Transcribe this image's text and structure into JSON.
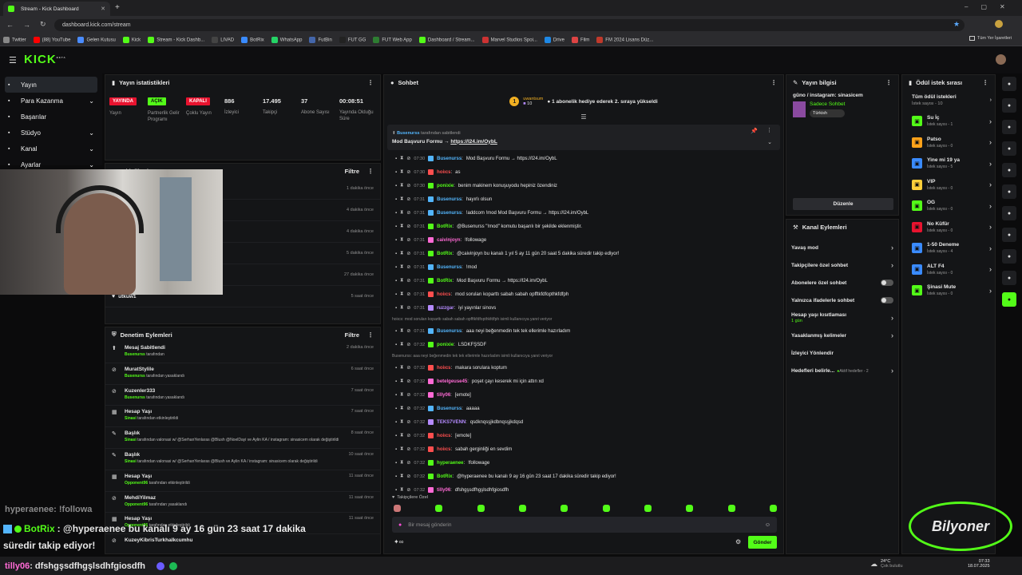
{
  "browser": {
    "tab_title": "Stream - Kick Dashboard",
    "url": "dashboard.kick.com/stream",
    "bookmarks": [
      "Twitter",
      "(88) YouTube",
      "Gelen Kutusu",
      "Kick",
      "Stream - Kick Dashb...",
      "LIVAD",
      "BotRix",
      "WhatsApp",
      "FutBin",
      "FUT GG",
      "FUT Web App",
      "Dashboard / Stream...",
      "Marvel Studios Spoi...",
      "Drive",
      "Film",
      "FM 2024 Lisans Düz..."
    ],
    "all_bookmarks": "Tüm Yer İşaretleri"
  },
  "app": {
    "logo": "KICK",
    "logo_sup": "BETA"
  },
  "sidebar": {
    "items": [
      {
        "icon": "live-icon",
        "label": "Yayın",
        "active": true,
        "chevron": false
      },
      {
        "icon": "money-icon",
        "label": "Para Kazanma",
        "active": false,
        "chevron": true
      },
      {
        "icon": "trophy-icon",
        "label": "Başarılar",
        "active": false,
        "chevron": false
      },
      {
        "icon": "studio-icon",
        "label": "Stüdyo",
        "active": false,
        "chevron": true
      },
      {
        "icon": "channel-icon",
        "label": "Kanal",
        "active": false,
        "chevron": true
      },
      {
        "icon": "gear-icon",
        "label": "Ayarlar",
        "active": false,
        "chevron": true
      }
    ]
  },
  "stats": {
    "title": "Yayın istatistikleri",
    "items": [
      {
        "badge": "YAYINDA",
        "badge_color": "#e8132f",
        "label": "Yayın"
      },
      {
        "badge": "AÇIK",
        "badge_color": "#53fc18",
        "label": "Partnerlik Gelir Programı"
      },
      {
        "badge": "KAPALI",
        "badge_color": "#e8132f",
        "label": "Çoklu Yayın"
      },
      {
        "value": "886",
        "label": "İzleyici"
      },
      {
        "value": "17.495",
        "label": "Takipçi"
      },
      {
        "value": "37",
        "label": "Abone Sayısı"
      },
      {
        "value": "00:08:51",
        "label": "Yayında Olduğu Süre"
      }
    ]
  },
  "activity": {
    "title": "Etkinlik Akışı",
    "filter": "Filtre",
    "times": [
      "1 dakika önce",
      "4 dakika önce",
      "4 dakika önce",
      "5 dakika önce",
      "27 dakika önce",
      "5 saat önce"
    ],
    "partial_user": "mellimori",
    "partial_note": "kanalı takip etti",
    "last_user": "utkuw1"
  },
  "moderation": {
    "title": "Denetim Eylemleri",
    "filter": "Filtre",
    "items": [
      {
        "icon": "pin-icon",
        "title": "Mesaj Sabitlendi",
        "by": "Busenurss",
        "rest": "tarafından",
        "time": "2 dakika önce"
      },
      {
        "icon": "ban-icon",
        "title": "MuratStylile",
        "by": "Busenurss",
        "rest": "tarafından yasaklandı",
        "time": "6 saat önce"
      },
      {
        "icon": "ban-icon",
        "title": "Kuzenler333",
        "by": "Busenurss",
        "rest": "tarafından yasaklandı",
        "time": "7 saat önce"
      },
      {
        "icon": "calendar-icon",
        "title": "Hesap Yaşı",
        "by": "Sinasi",
        "rest": "tarafından etkinleştirildi",
        "time": "7 saat önce"
      },
      {
        "icon": "edit-icon",
        "title": "Başlık",
        "by": "Sinasi",
        "rest": "tarafından valonasi w/ @SerhanYenlaras @Blush @NoelDayi ve Aylin KA / instagram: sinasicem olarak değiştirildi",
        "time": "8 saat önce"
      },
      {
        "icon": "edit-icon",
        "title": "Başlık",
        "by": "Sinasi",
        "rest": "tarafından valonasi w/ @SerhanYenlaras @Blush ve Aylin KA / instagram: sinasicem olarak değiştirildi",
        "time": "10 saat önce"
      },
      {
        "icon": "calendar-icon",
        "title": "Hesap Yaşı",
        "by": "Opponent96",
        "rest": "tarafından etkinleştirildi",
        "time": "11 saat önce"
      },
      {
        "icon": "ban-icon",
        "title": "MehdiYilmaz",
        "by": "Opponent96",
        "rest": "tarafından yasaklandı",
        "time": "11 saat önce"
      },
      {
        "icon": "calendar-icon",
        "title": "Hesap Yaşı",
        "by": "Opponent96",
        "rest": "tarafından etkinleştirildi",
        "time": "11 saat önce"
      },
      {
        "icon": "ban-icon",
        "title": "KuzeyKibrisTurkhalkcumhu",
        "by": "",
        "rest": "",
        "time": ""
      }
    ]
  },
  "chat": {
    "title": "Sohbet",
    "gift_user": "uwantsum",
    "gift_count": "10",
    "gift_text": "1 abonelik hediye ederek 2. sıraya yükseldi",
    "pinned_by": "Busenurss",
    "pinned_rest": "tarafından sabitlendi",
    "pinned_msg": "Mod Başvuru Formu →",
    "pinned_link": "https://l24.im/OybL",
    "messages": [
      {
        "t": "07:30",
        "u": "Busenurss",
        "c": "#53b5fc",
        "m": "Mod Başvuru Formu → https://l24.im/OybL"
      },
      {
        "t": "07:30",
        "u": "hoiıcs",
        "c": "#ff4f4f",
        "m": "as"
      },
      {
        "t": "07:30",
        "u": "ponixie",
        "c": "#53fc18",
        "m": "benim makinem konuşuyodu hepiniz özendiniz"
      },
      {
        "t": "07:31",
        "u": "Busenurss",
        "c": "#53b5fc",
        "m": "hayırlı olsun"
      },
      {
        "t": "07:31",
        "u": "Busenurss",
        "c": "#53b5fc",
        "m": "!addcom !mod Mod Başvuru Formu → https://l24.im/OybL"
      },
      {
        "t": "07:31",
        "u": "BotRix",
        "c": "#53fc18",
        "m": "@Busenurss \"!mod\" komutu başarılı bir şekilde eklenmiştir."
      },
      {
        "t": "07:31",
        "u": "caivinjoyn",
        "c": "#ff6ad5",
        "m": "!followage"
      },
      {
        "t": "07:31",
        "u": "BotRix",
        "c": "#53fc18",
        "m": "@caivinjoyn bu kanalı 1 yıl 5 ay 11 gün 20 saat 5 dakika süredir takip ediyor!"
      },
      {
        "t": "07:31",
        "u": "Busenurss",
        "c": "#53b5fc",
        "m": "!mod"
      },
      {
        "t": "07:31",
        "u": "BotRix",
        "c": "#53fc18",
        "m": "Mod Başvuru Formu → https://l24.im/OybL"
      },
      {
        "t": "07:31",
        "u": "hoiıcs",
        "c": "#ff4f4f",
        "m": "mod soruları koparttı sabah sabah opfftkfdfopthkfdfph"
      },
      {
        "t": "07:31",
        "u": "ruzzgar",
        "c": "#b58bff",
        "m": "iyi yayınlar sinovs"
      },
      {
        "reply": "hoiıcs: mod soruları koparttı sabah sabah opfftkfdfopthkfdfph isimli kullanıcıya yanıt veriyor"
      },
      {
        "t": "07:31",
        "u": "Busenurss",
        "c": "#53b5fc",
        "m": "aaa neyi beğenmedin tek tek ellerimle hazırladım"
      },
      {
        "t": "07:32",
        "u": "ponixie",
        "c": "#53fc18",
        "m": "LSDKFŞSDF"
      },
      {
        "reply": "Busenurss: aaa neyi beğenmedin tek tek ellerimle hazırladım isimli kullanıcıya yanıt veriyor"
      },
      {
        "t": "07:32",
        "u": "hoiıcs",
        "c": "#ff4f4f",
        "m": "makara sorulara koptum"
      },
      {
        "t": "07:32",
        "u": "betelgeuse45",
        "c": "#ff6ad5",
        "m": "poşet çayı keserek mi için attın xd"
      },
      {
        "t": "07:32",
        "u": "tilly06",
        "c": "#ff6ad5",
        "m": "[emote]"
      },
      {
        "t": "07:32",
        "u": "Busenurss",
        "c": "#53b5fc",
        "m": "aaaaa"
      },
      {
        "t": "07:32",
        "u": "TEKS7VENN",
        "c": "#b58bff",
        "m": "qsdknqsşjkdbnqsşjkdqsd"
      },
      {
        "t": "07:32",
        "u": "hoiıcs",
        "c": "#ff4f4f",
        "m": "[emote]"
      },
      {
        "t": "07:32",
        "u": "hoiıcs",
        "c": "#ff4f4f",
        "m": "sabah gerginliği en sevdim"
      },
      {
        "t": "07:32",
        "u": "hyperaenee",
        "c": "#53fc18",
        "m": "!followage"
      },
      {
        "t": "07:32",
        "u": "BotRix",
        "c": "#53fc18",
        "m": "@hyperaenee bu kanalı 9 ay 16 gün 23 saat 17 dakika süredir takip ediyor!"
      },
      {
        "t": "07:32",
        "u": "tilly06",
        "c": "#ff6ad5",
        "m": "dfshgşsdfhgşlsdhfgiosdfh"
      }
    ],
    "followers_only_label": "Takipçilere Özel",
    "input_placeholder": "Bir mesaj gönderin",
    "send_label": "Gönder"
  },
  "stream_info": {
    "title": "Yayın bilgisi",
    "stream_title": "güno / instagram: sinasicem",
    "category": "Sadece Sohbet",
    "language": "Türkish",
    "edit_label": "Düzenle"
  },
  "channel_actions": {
    "title": "Kanal Eylemleri",
    "items": [
      {
        "label": "Yavaş mod",
        "type": "chevron"
      },
      {
        "label": "Takipçilere özel sohbet",
        "type": "chevron"
      },
      {
        "label": "Abonelere özel sohbet",
        "type": "toggle"
      },
      {
        "label": "Yalnızca ifadelerle sohbet",
        "type": "toggle"
      },
      {
        "label": "Hesap yaşı kısıtlaması",
        "sub": "1 gün",
        "type": "chevron"
      },
      {
        "label": "Yasaklanmış kelimeler",
        "type": "chevron"
      },
      {
        "label": "İzleyici Yönlendir",
        "type": "none"
      },
      {
        "label": "Hedefleri belirle...",
        "extra": "Aktif hedefler - 2",
        "type": "chevron"
      }
    ]
  },
  "rewards": {
    "title": "Ödül istek sırası",
    "all_label": "Tüm ödül istekleri",
    "all_count": "İstek sayısı - 10",
    "items": [
      {
        "name": "Su İç",
        "count": "İstek sayısı - 1",
        "color": "#53fc18"
      },
      {
        "name": "Patso",
        "count": "İstek sayısı - 0",
        "color": "#ffa21a"
      },
      {
        "name": "Yine mi 19 ya",
        "count": "İstek sayısı - 5",
        "color": "#3a8bff"
      },
      {
        "name": "VIP",
        "count": "İstek sayısı - 0",
        "color": "#ffcf3a"
      },
      {
        "name": "OG",
        "count": "İstek sayısı - 0",
        "color": "#53fc18"
      },
      {
        "name": "No Küfür",
        "count": "İstek sayısı - 0",
        "color": "#e8132f"
      },
      {
        "name": "1-50 Deneme",
        "count": "İstek sayısı - 4",
        "color": "#3a8bff"
      },
      {
        "name": "ALT F4",
        "count": "İstek sayısı - 0",
        "color": "#3a8bff"
      },
      {
        "name": "Şinasi Mute",
        "count": "İstek sayısı - 0",
        "color": "#53fc18"
      }
    ]
  },
  "overlay": {
    "ghost_text": "hyperaenee: !followa",
    "bot_name": "BotRix",
    "bot_msg_1": ": @hyperaenee bu kanalı 9 ay 16 gün 23 saat 17 dakika",
    "bot_msg_2": "süredir takip ediyor!",
    "bottom_user": "tilly06",
    "bottom_msg": ": dfshgşsdfhgşlsdhfgiosdfh",
    "sponsor": "Bilyoner"
  },
  "taskbar": {
    "weather_temp": "24°C",
    "weather_text": "Çok bulutlu",
    "time": "07:33",
    "date": "18.07.2025"
  }
}
